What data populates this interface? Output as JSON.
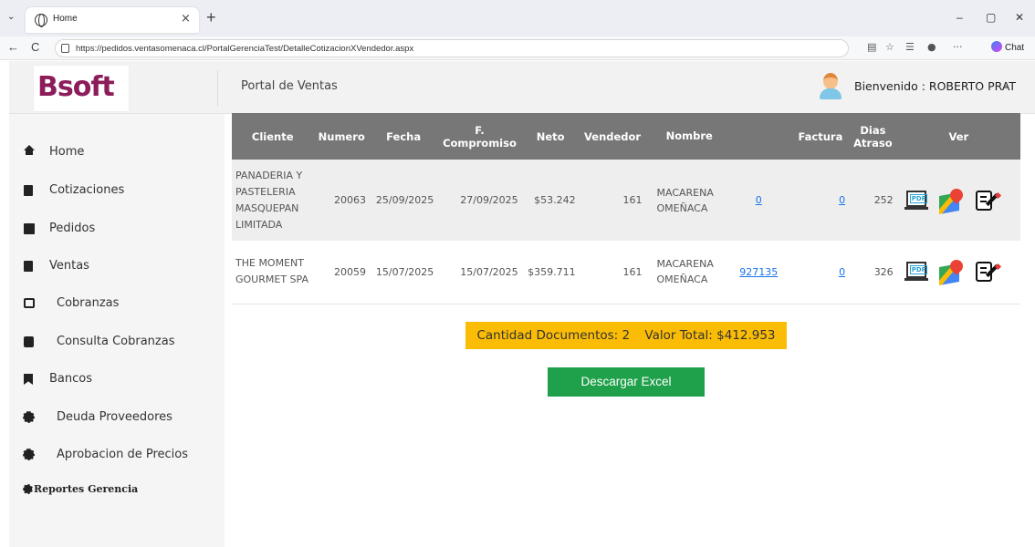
{
  "browser": {
    "tab_title": "Home",
    "tab_close": "×",
    "new_tab": "+",
    "url": "https://pedidos.ventasomenaca.cl/PortalGerenciaTest/DetalleCotizacionXVendedor.aspx",
    "chat_label": "Chat",
    "win_min": "–",
    "win_max": "▢",
    "win_close": "✕",
    "back": "←",
    "reload": "C"
  },
  "header": {
    "logo_text": "Bsoft",
    "portal_title": "Portal de Ventas",
    "welcome": "Bienvenido : ROBERTO PRAT",
    "caret": "⌄"
  },
  "sidebar": {
    "items": [
      {
        "label": "Home",
        "icon": "home-icon"
      },
      {
        "label": "Cotizaciones",
        "icon": "file-icon"
      },
      {
        "label": "Pedidos",
        "icon": "calendar-icon"
      },
      {
        "label": "Ventas",
        "icon": "file-icon"
      },
      {
        "label": "Cobranzas",
        "icon": "edit-icon"
      },
      {
        "label": "Consulta Cobranzas",
        "icon": "book-icon"
      },
      {
        "label": "Bancos",
        "icon": "bookmark-icon"
      },
      {
        "label": "Deuda Proveedores",
        "icon": "gear-icon"
      },
      {
        "label": "Aprobacion de Precios",
        "icon": "gear-icon"
      }
    ],
    "reportes": "Reportes Gerencia"
  },
  "table": {
    "headers": {
      "cliente": "Cliente",
      "numero": "Numero",
      "fecha": "Fecha",
      "compromiso": "F. Compromiso",
      "neto": "Neto",
      "vendedor": "Vendedor",
      "nombre": "Nombre",
      "factura": "Factura",
      "dias": "Dias Atraso",
      "ver": "Ver"
    },
    "rows": [
      {
        "cliente": "PANADERIA Y PASTELERIA MASQUEPAN LIMITADA",
        "numero": "20063",
        "fecha": "25/09/2025",
        "compromiso": "27/09/2025",
        "neto": "$53.242",
        "vendedor": "161",
        "nombre": "MACARENA OMEÑACA",
        "link1": "0",
        "factura": "0",
        "dias": "252"
      },
      {
        "cliente": "THE MOMENT GOURMET SPA",
        "numero": "20059",
        "fecha": "15/07/2025",
        "compromiso": "15/07/2025",
        "neto": "$359.711",
        "vendedor": "161",
        "nombre": "MACARENA OMEÑACA",
        "link1": "927135",
        "factura": "0",
        "dias": "326"
      }
    ]
  },
  "summary": {
    "cantidad": "Cantidad Documentos: 2",
    "valor": "Valor Total: $412.953"
  },
  "excel_button": "Descargar Excel",
  "colors": {
    "table_header": "#777777",
    "summary_bg": "#fbbc05",
    "excel_bg": "#1fa04a",
    "link": "#1a73e8"
  }
}
